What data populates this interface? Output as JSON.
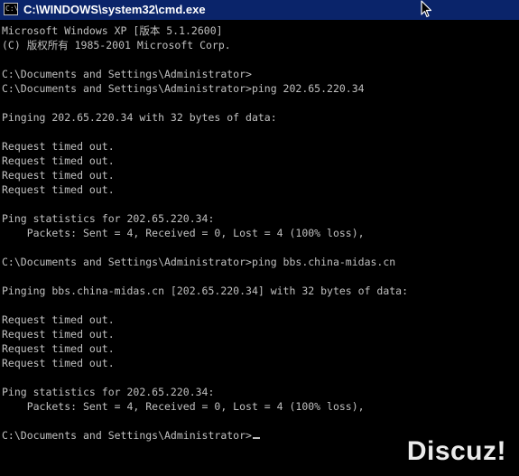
{
  "window": {
    "title": "C:\\WINDOWS\\system32\\cmd.exe",
    "icon": "cmd-icon",
    "icon_text": "C:\\"
  },
  "console": {
    "lines": [
      "Microsoft Windows XP [版本 5.1.2600]",
      "(C) 版权所有 1985-2001 Microsoft Corp.",
      "",
      "C:\\Documents and Settings\\Administrator>",
      "C:\\Documents and Settings\\Administrator>ping 202.65.220.34",
      "",
      "Pinging 202.65.220.34 with 32 bytes of data:",
      "",
      "Request timed out.",
      "Request timed out.",
      "Request timed out.",
      "Request timed out.",
      "",
      "Ping statistics for 202.65.220.34:",
      "    Packets: Sent = 4, Received = 0, Lost = 4 (100% loss),",
      "",
      "C:\\Documents and Settings\\Administrator>ping bbs.china-midas.cn",
      "",
      "Pinging bbs.china-midas.cn [202.65.220.34] with 32 bytes of data:",
      "",
      "Request timed out.",
      "Request timed out.",
      "Request timed out.",
      "Request timed out.",
      "",
      "Ping statistics for 202.65.220.34:",
      "    Packets: Sent = 4, Received = 0, Lost = 4 (100% loss),",
      ""
    ],
    "prompt": "C:\\Documents and Settings\\Administrator>"
  },
  "watermark": {
    "text": "Discuz!"
  },
  "colors": {
    "titlebar": "#0a246a",
    "console_bg": "#000000",
    "console_fg": "#c0c0c0"
  }
}
